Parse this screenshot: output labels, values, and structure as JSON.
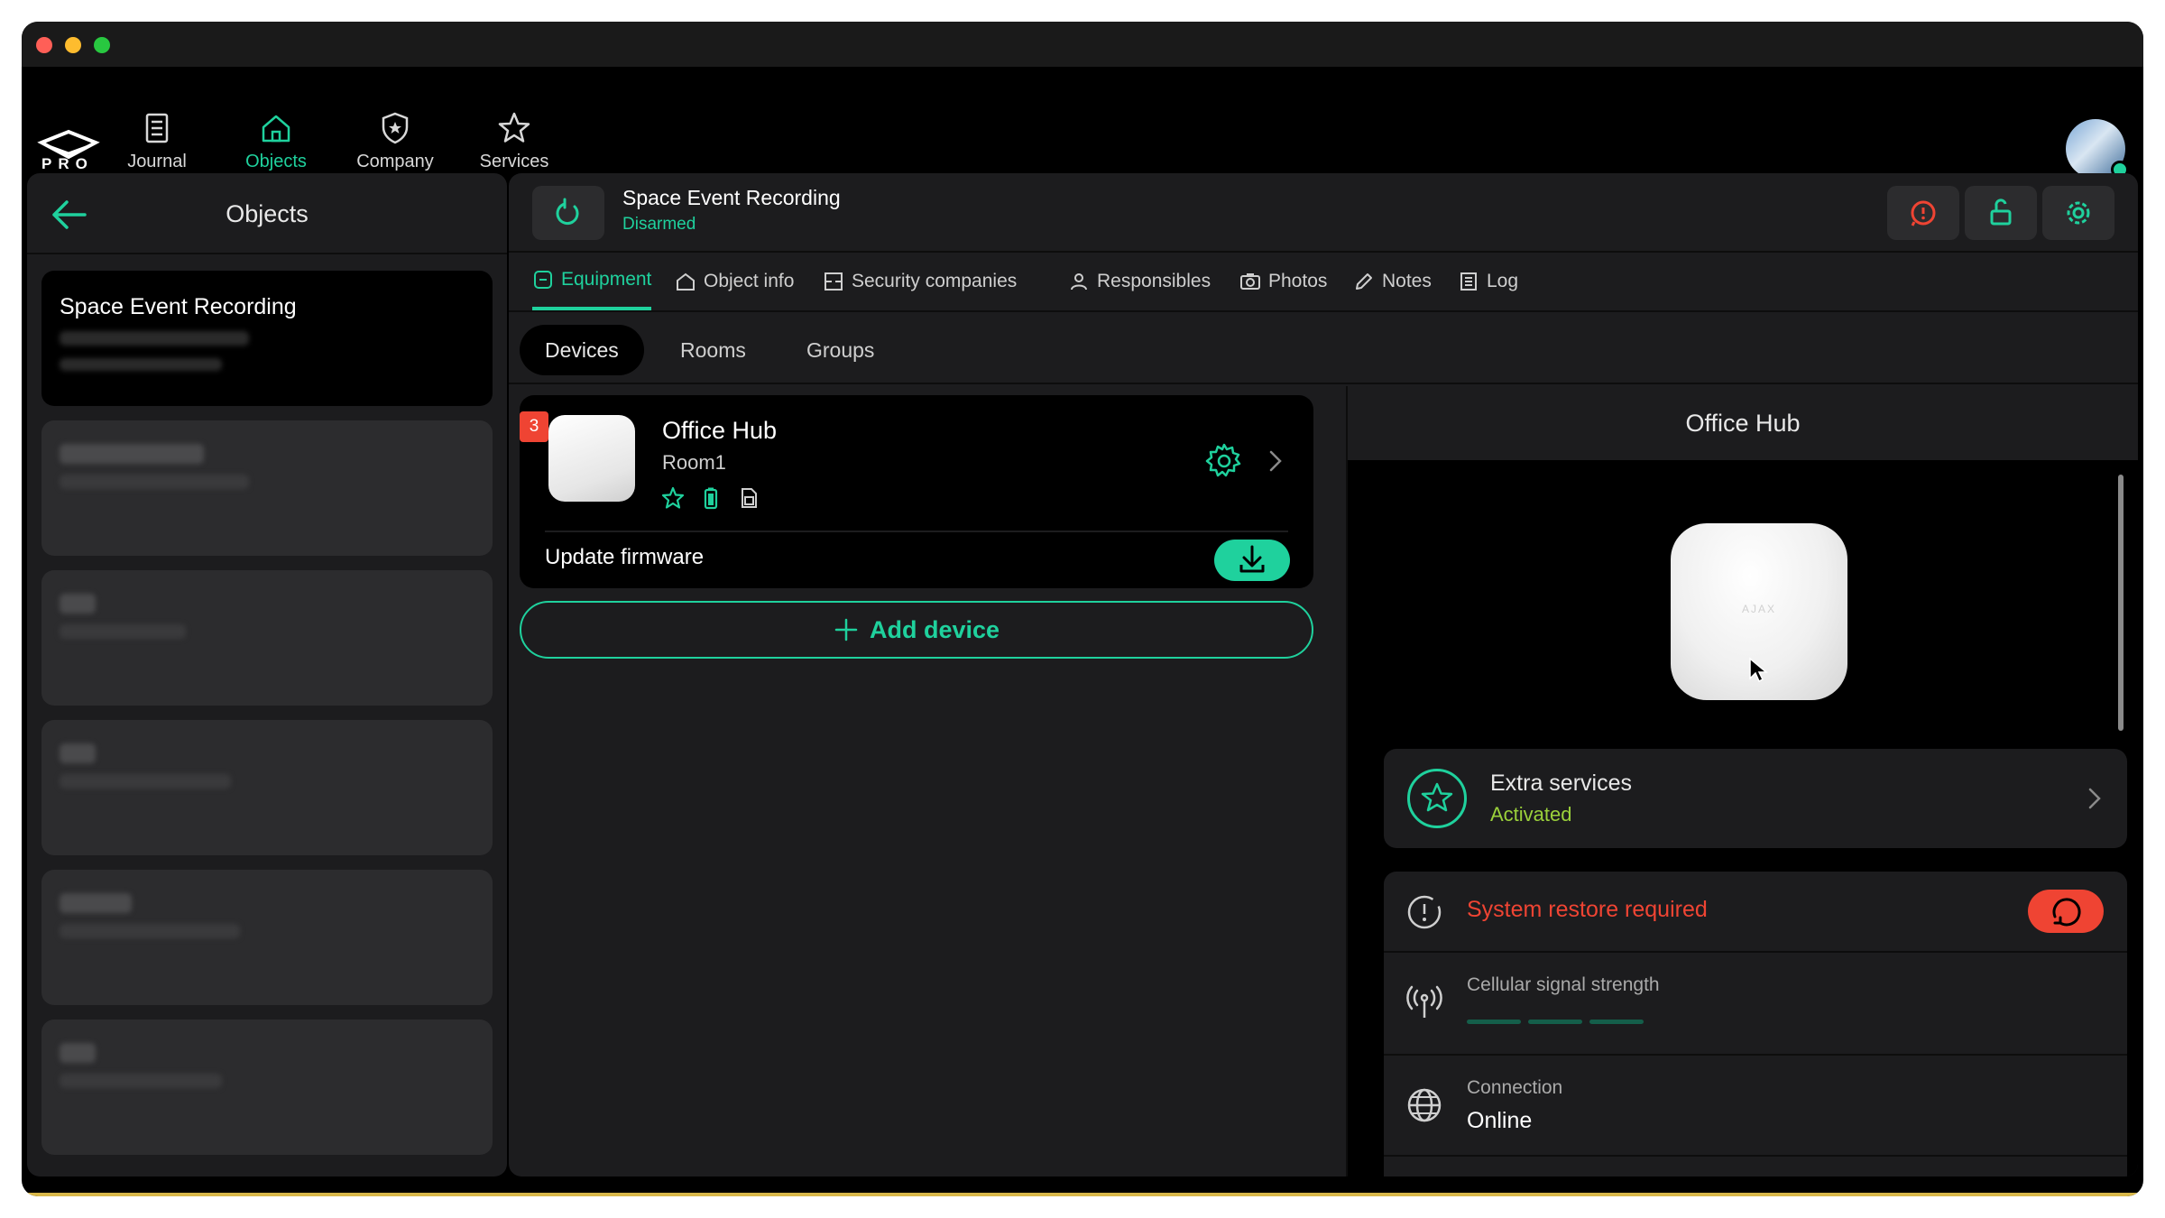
{
  "nav": {
    "logo_text": "PRO",
    "items": [
      {
        "label": "Journal",
        "icon": "journal-icon"
      },
      {
        "label": "Objects",
        "icon": "home-icon",
        "active": true
      },
      {
        "label": "Company",
        "icon": "shield-star-icon"
      },
      {
        "label": "Services",
        "icon": "star-icon"
      }
    ]
  },
  "sidebar": {
    "title": "Objects",
    "objects": [
      {
        "name": "Space Event Recording",
        "active": true
      }
    ]
  },
  "object": {
    "title": "Space Event Recording",
    "status": "Disarmed"
  },
  "tabs": [
    {
      "label": "Equipment",
      "icon": "equipment-icon",
      "active": true
    },
    {
      "label": "Object info",
      "icon": "home-icon"
    },
    {
      "label": "Security companies",
      "icon": "company-icon"
    },
    {
      "label": "Responsibles",
      "icon": "person-icon"
    },
    {
      "label": "Photos",
      "icon": "camera-icon"
    },
    {
      "label": "Notes",
      "icon": "pencil-icon"
    },
    {
      "label": "Log",
      "icon": "log-icon"
    }
  ],
  "subtabs": [
    {
      "label": "Devices",
      "active": true
    },
    {
      "label": "Rooms"
    },
    {
      "label": "Groups"
    }
  ],
  "device": {
    "badge": "3",
    "name": "Office Hub",
    "room": "Room1",
    "update_label": "Update firmware"
  },
  "add_device_label": "Add device",
  "detail": {
    "title": "Office Hub",
    "image_text": "AJAX",
    "extra_services": {
      "title": "Extra services",
      "status": "Activated"
    },
    "restore": "System restore required",
    "cellular_label": "Cellular signal strength",
    "connection_label": "Connection",
    "connection_value": "Online"
  },
  "colors": {
    "accent": "#1fd19d",
    "alert": "#ef4433",
    "activated": "#9bd13b",
    "background": "#000000",
    "panel": "#1c1c1e"
  }
}
